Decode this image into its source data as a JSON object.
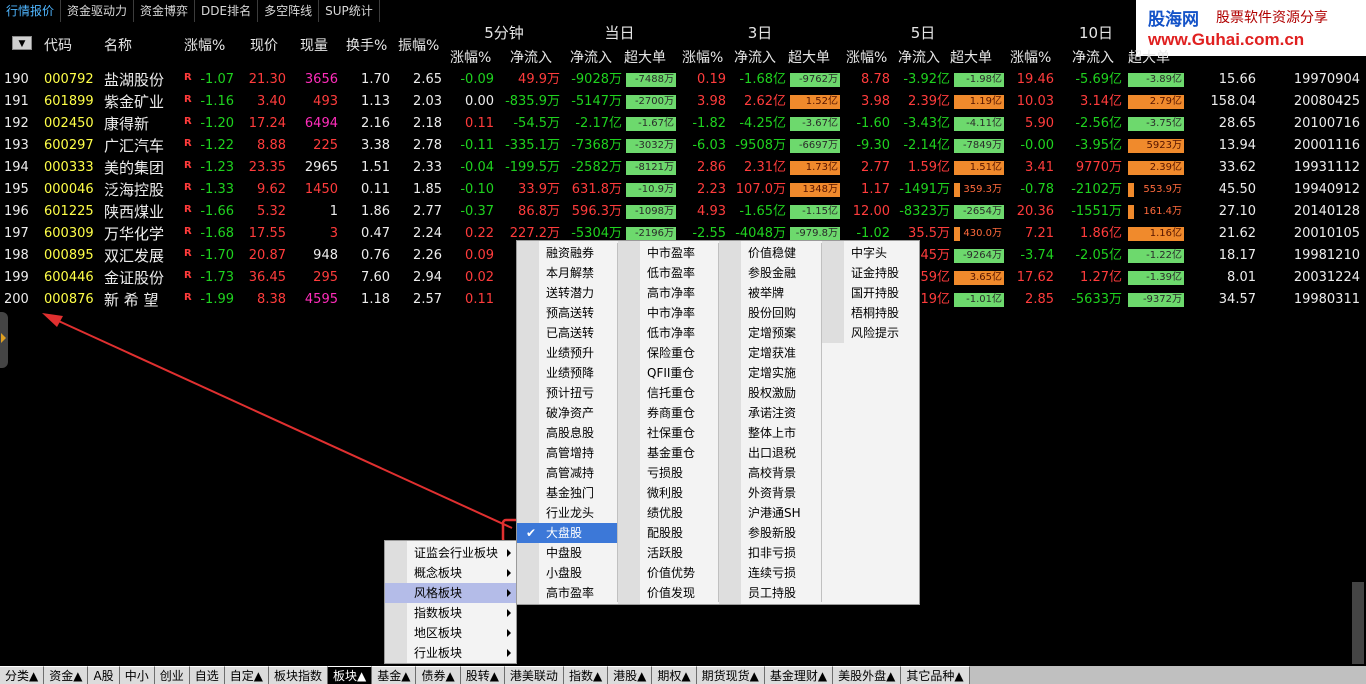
{
  "top_tabs": [
    "行情报价",
    "资金驱动力",
    "资金博弈",
    "DDE排名",
    "多空阵线",
    "SUP统计"
  ],
  "logo": {
    "name": "股海网",
    "slogan": "股票软件资源分享",
    "url": "www.Guhai.com.cn"
  },
  "header": {
    "groups": [
      "5分钟",
      "当日",
      "3日",
      "5日",
      "10日"
    ],
    "columns": [
      "代码",
      "名称",
      "涨幅%",
      "现价",
      "现量",
      "换手%",
      "振幅%",
      "涨幅%",
      "净流入",
      "净流入",
      "超大单",
      "涨幅%",
      "净流入",
      "超大单",
      "涨幅%",
      "净流入",
      "超大单",
      "涨幅%",
      "净流入",
      "超大单"
    ],
    "menu_button": "▼"
  },
  "rows": [
    {
      "no": "190",
      "code": "000792",
      "name": "盐湖股份",
      "chg": "-1.07",
      "price": "21.30",
      "vol": "3656",
      "turn": "1.70",
      "amp": "2.65",
      "m5": "-0.09",
      "m5_flow": "49.9万",
      "d_flow": "-9028万",
      "d_big": "-7488万",
      "d3_chg": "0.19",
      "d3_flow": "-1.68亿",
      "d3_big": "-9762万",
      "d5_chg": "8.78",
      "d5_flow": "-3.92亿",
      "d5_big": "-1.98亿",
      "d10_chg": "19.46",
      "d10_flow": "-5.69亿",
      "d10_big": "-3.89亿",
      "x1": "15.66",
      "date": "19970904"
    },
    {
      "no": "191",
      "code": "601899",
      "name": "紫金矿业",
      "chg": "-1.16",
      "price": "3.40",
      "vol": "493",
      "turn": "1.13",
      "amp": "2.03",
      "m5": "0.00",
      "m5_flow": "-835.9万",
      "d_flow": "-5147万",
      "d_big": "-2700万",
      "d3_chg": "3.98",
      "d3_flow": "2.62亿",
      "d3_big": "1.52亿",
      "d5_chg": "3.98",
      "d5_flow": "2.39亿",
      "d5_big": "1.19亿",
      "d10_chg": "10.03",
      "d10_flow": "3.14亿",
      "d10_big": "2.79亿",
      "x1": "158.04",
      "date": "20080425"
    },
    {
      "no": "192",
      "code": "002450",
      "name": "康得新",
      "chg": "-1.20",
      "price": "17.24",
      "vol": "6494",
      "turn": "2.16",
      "amp": "2.18",
      "m5": "0.11",
      "m5_flow": "-54.5万",
      "d_flow": "-2.17亿",
      "d_big": "-1.67亿",
      "d3_chg": "-1.82",
      "d3_flow": "-4.25亿",
      "d3_big": "-3.67亿",
      "d5_chg": "-1.60",
      "d5_flow": "-3.43亿",
      "d5_big": "-4.11亿",
      "d10_chg": "5.90",
      "d10_flow": "-2.56亿",
      "d10_big": "-3.75亿",
      "x1": "28.65",
      "date": "20100716"
    },
    {
      "no": "193",
      "code": "600297",
      "name": "广汇汽车",
      "chg": "-1.22",
      "price": "8.88",
      "vol": "225",
      "turn": "3.38",
      "amp": "2.78",
      "m5": "-0.11",
      "m5_flow": "-335.1万",
      "d_flow": "-7368万",
      "d_big": "-3032万",
      "d3_chg": "-6.03",
      "d3_flow": "-9508万",
      "d3_big": "-6697万",
      "d5_chg": "-9.30",
      "d5_flow": "-2.14亿",
      "d5_big": "-7849万",
      "d10_chg": "-0.00",
      "d10_flow": "-3.95亿",
      "d10_big": "5923万",
      "x1": "13.94",
      "date": "20001116"
    },
    {
      "no": "194",
      "code": "000333",
      "name": "美的集团",
      "chg": "-1.23",
      "price": "23.35",
      "vol": "2965",
      "turn": "1.51",
      "amp": "2.33",
      "m5": "-0.04",
      "m5_flow": "-199.5万",
      "d_flow": "-2582万",
      "d_big": "-8121万",
      "d3_chg": "2.86",
      "d3_flow": "2.31亿",
      "d3_big": "1.73亿",
      "d5_chg": "2.77",
      "d5_flow": "1.59亿",
      "d5_big": "1.51亿",
      "d10_chg": "3.41",
      "d10_flow": "9770万",
      "d10_big": "2.39亿",
      "x1": "33.62",
      "date": "19931112"
    },
    {
      "no": "195",
      "code": "000046",
      "name": "泛海控股",
      "chg": "-1.33",
      "price": "9.62",
      "vol": "1450",
      "turn": "0.11",
      "amp": "1.85",
      "m5": "-0.10",
      "m5_flow": "33.9万",
      "d_flow": "631.8万",
      "d_big": "-10.9万",
      "d3_chg": "2.23",
      "d3_flow": "107.0万",
      "d3_big": "1348万",
      "d5_chg": "1.17",
      "d5_flow": "-1491万",
      "d5_big": "359.3万",
      "d10_chg": "-0.78",
      "d10_flow": "-2102万",
      "d10_big": "553.9万",
      "x1": "45.50",
      "date": "19940912"
    },
    {
      "no": "196",
      "code": "601225",
      "name": "陕西煤业",
      "chg": "-1.66",
      "price": "5.32",
      "vol": "1",
      "turn": "1.86",
      "amp": "2.77",
      "m5": "-0.37",
      "m5_flow": "86.8万",
      "d_flow": "596.3万",
      "d_big": "-1098万",
      "d3_chg": "4.93",
      "d3_flow": "-1.65亿",
      "d3_big": "-1.15亿",
      "d5_chg": "12.00",
      "d5_flow": "-8323万",
      "d5_big": "-2654万",
      "d10_chg": "20.36",
      "d10_flow": "-1551万",
      "d10_big": "161.4万",
      "x1": "27.10",
      "date": "20140128"
    },
    {
      "no": "197",
      "code": "600309",
      "name": "万华化学",
      "chg": "-1.68",
      "price": "17.55",
      "vol": "3",
      "turn": "0.47",
      "amp": "2.24",
      "m5": "0.22",
      "m5_flow": "227.2万",
      "d_flow": "-5304万",
      "d_big": "-2196万",
      "d3_chg": "-2.55",
      "d3_flow": "-4048万",
      "d3_big": "-979.8万",
      "d5_chg": "-1.02",
      "d5_flow": "35.5万",
      "d5_big": "430.0万",
      "d10_chg": "7.21",
      "d10_flow": "1.86亿",
      "d10_big": "1.16亿",
      "x1": "21.62",
      "date": "20010105"
    },
    {
      "no": "198",
      "code": "000895",
      "name": "双汇发展",
      "chg": "-1.70",
      "price": "20.87",
      "vol": "948",
      "turn": "0.76",
      "amp": "2.26",
      "m5": "0.09",
      "m5_flow": "",
      "d_flow": "",
      "d_big": "",
      "d3_chg": "",
      "d3_flow": "",
      "d3_big": "",
      "d5_chg": "",
      "d5_flow": "45万",
      "d5_big": "-9264万",
      "d10_chg": "-3.74",
      "d10_flow": "-2.05亿",
      "d10_big": "-1.22亿",
      "x1": "18.17",
      "date": "19981210"
    },
    {
      "no": "199",
      "code": "600446",
      "name": "金证股份",
      "chg": "-1.73",
      "price": "36.45",
      "vol": "295",
      "turn": "7.60",
      "amp": "2.94",
      "m5": "0.02",
      "m5_flow": "-3",
      "d_flow": "",
      "d_big": "",
      "d3_chg": "",
      "d3_flow": "",
      "d3_big": "",
      "d5_chg": "",
      "d5_flow": "59亿",
      "d5_big": "3.65亿",
      "d10_chg": "17.62",
      "d10_flow": "1.27亿",
      "d10_big": "-1.39亿",
      "x1": "8.01",
      "date": "20031224"
    },
    {
      "no": "200",
      "code": "000876",
      "name": "新 希 望",
      "chg": "-1.99",
      "price": "8.38",
      "vol": "4595",
      "turn": "1.18",
      "amp": "2.57",
      "m5": "0.11",
      "m5_flow": "",
      "d_flow": "",
      "d_big": "",
      "d3_chg": "",
      "d3_flow": "",
      "d3_big": "",
      "d5_chg": "",
      "d5_flow": "19亿",
      "d5_big": "-1.01亿",
      "d10_chg": "2.85",
      "d10_flow": "-5633万",
      "d10_big": "-9372万",
      "x1": "34.57",
      "date": "19980311"
    }
  ],
  "context_menu": {
    "items": [
      "证监会行业板块",
      "概念板块",
      "风格板块",
      "指数板块",
      "地区板块",
      "行业板块"
    ],
    "highlighted": "风格板块"
  },
  "submenu": {
    "col1": [
      "融资融券",
      "本月解禁",
      "送转潜力",
      "预高送转",
      "已高送转",
      "业绩预升",
      "业绩预降",
      "预计扭亏",
      "破净资产",
      "高股息股",
      "高管增持",
      "高管减持",
      "基金独门",
      "行业龙头",
      "大盘股",
      "中盘股",
      "小盘股",
      "高市盈率"
    ],
    "col2": [
      "中市盈率",
      "低市盈率",
      "高市净率",
      "中市净率",
      "低市净率",
      "保险重仓",
      "QFII重仓",
      "信托重仓",
      "券商重仓",
      "社保重仓",
      "基金重仓",
      "亏损股",
      "微利股",
      "绩优股",
      "配股股",
      "活跃股",
      "价值优势",
      "价值发现"
    ],
    "col3": [
      "价值稳健",
      "参股金融",
      "被举牌",
      "股份回购",
      "定增预案",
      "定增获准",
      "定增实施",
      "股权激励",
      "承诺注资",
      "整体上市",
      "出口退税",
      "高校背景",
      "外资背景",
      "沪港通SH",
      "参股新股",
      "扣非亏损",
      "连续亏损",
      "员工持股"
    ],
    "col4": [
      "中字头",
      "证金持股",
      "国开持股",
      "梧桐持股",
      "风险提示"
    ],
    "checked": "大盘股",
    "check_mark": "✔"
  },
  "bottom_tabs": [
    "分类▲",
    "资金▲",
    "A股",
    "中小",
    "创业",
    "自选",
    "自定▲",
    "板块指数",
    "板块▲",
    "基金▲",
    "债券▲",
    "股转▲",
    "港美联动",
    "指数▲",
    "港股▲",
    "期权▲",
    "期货现货▲",
    "基金理财▲",
    "美股外盘▲",
    "其它品种▲"
  ],
  "active_bottom_tab": "板块▲",
  "colors": {
    "up": "#ff3c3c",
    "down": "#1fd21f",
    "code": "#ffff48",
    "accent": "#4fb6ff",
    "annotation": "#e03030"
  }
}
